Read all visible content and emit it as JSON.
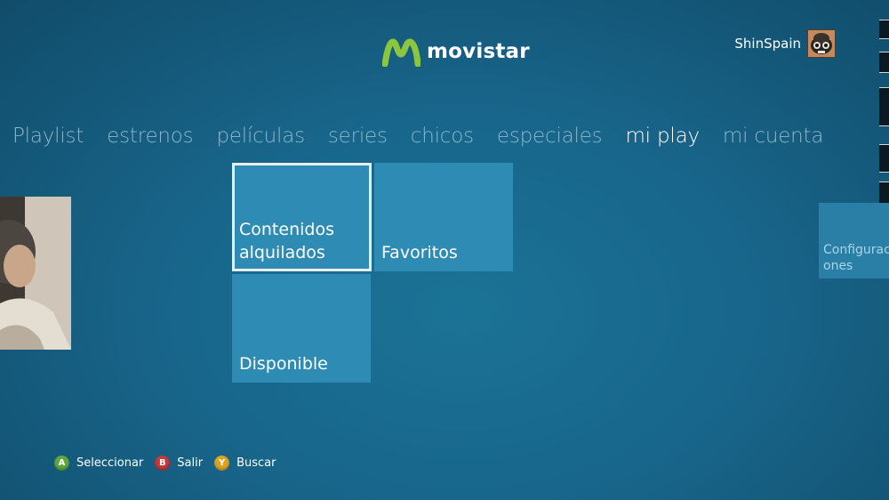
{
  "header": {
    "brand_name": "movistar",
    "brand_color": "#8cc63f",
    "user_name": "ShinSpain"
  },
  "nav": {
    "items": [
      {
        "label": "Playlist",
        "active": false
      },
      {
        "label": "estrenos",
        "active": false
      },
      {
        "label": "películas",
        "active": false
      },
      {
        "label": "series",
        "active": false
      },
      {
        "label": "chicos",
        "active": false
      },
      {
        "label": "especiales",
        "active": false
      },
      {
        "label": "mi play",
        "active": true
      },
      {
        "label": "mi cuenta",
        "active": false
      }
    ]
  },
  "tiles": {
    "contenidos": "Contenidos\nalquilados",
    "favoritos": "Favoritos",
    "disponible": "Disponible",
    "configuraciones": "Configuraciones"
  },
  "footer": {
    "hints": [
      {
        "button": "A",
        "label": "Seleccionar",
        "color": "#5ca83c"
      },
      {
        "button": "B",
        "label": "Salir",
        "color": "#c2393a"
      },
      {
        "button": "Y",
        "label": "Buscar",
        "color": "#d9a521"
      }
    ]
  }
}
